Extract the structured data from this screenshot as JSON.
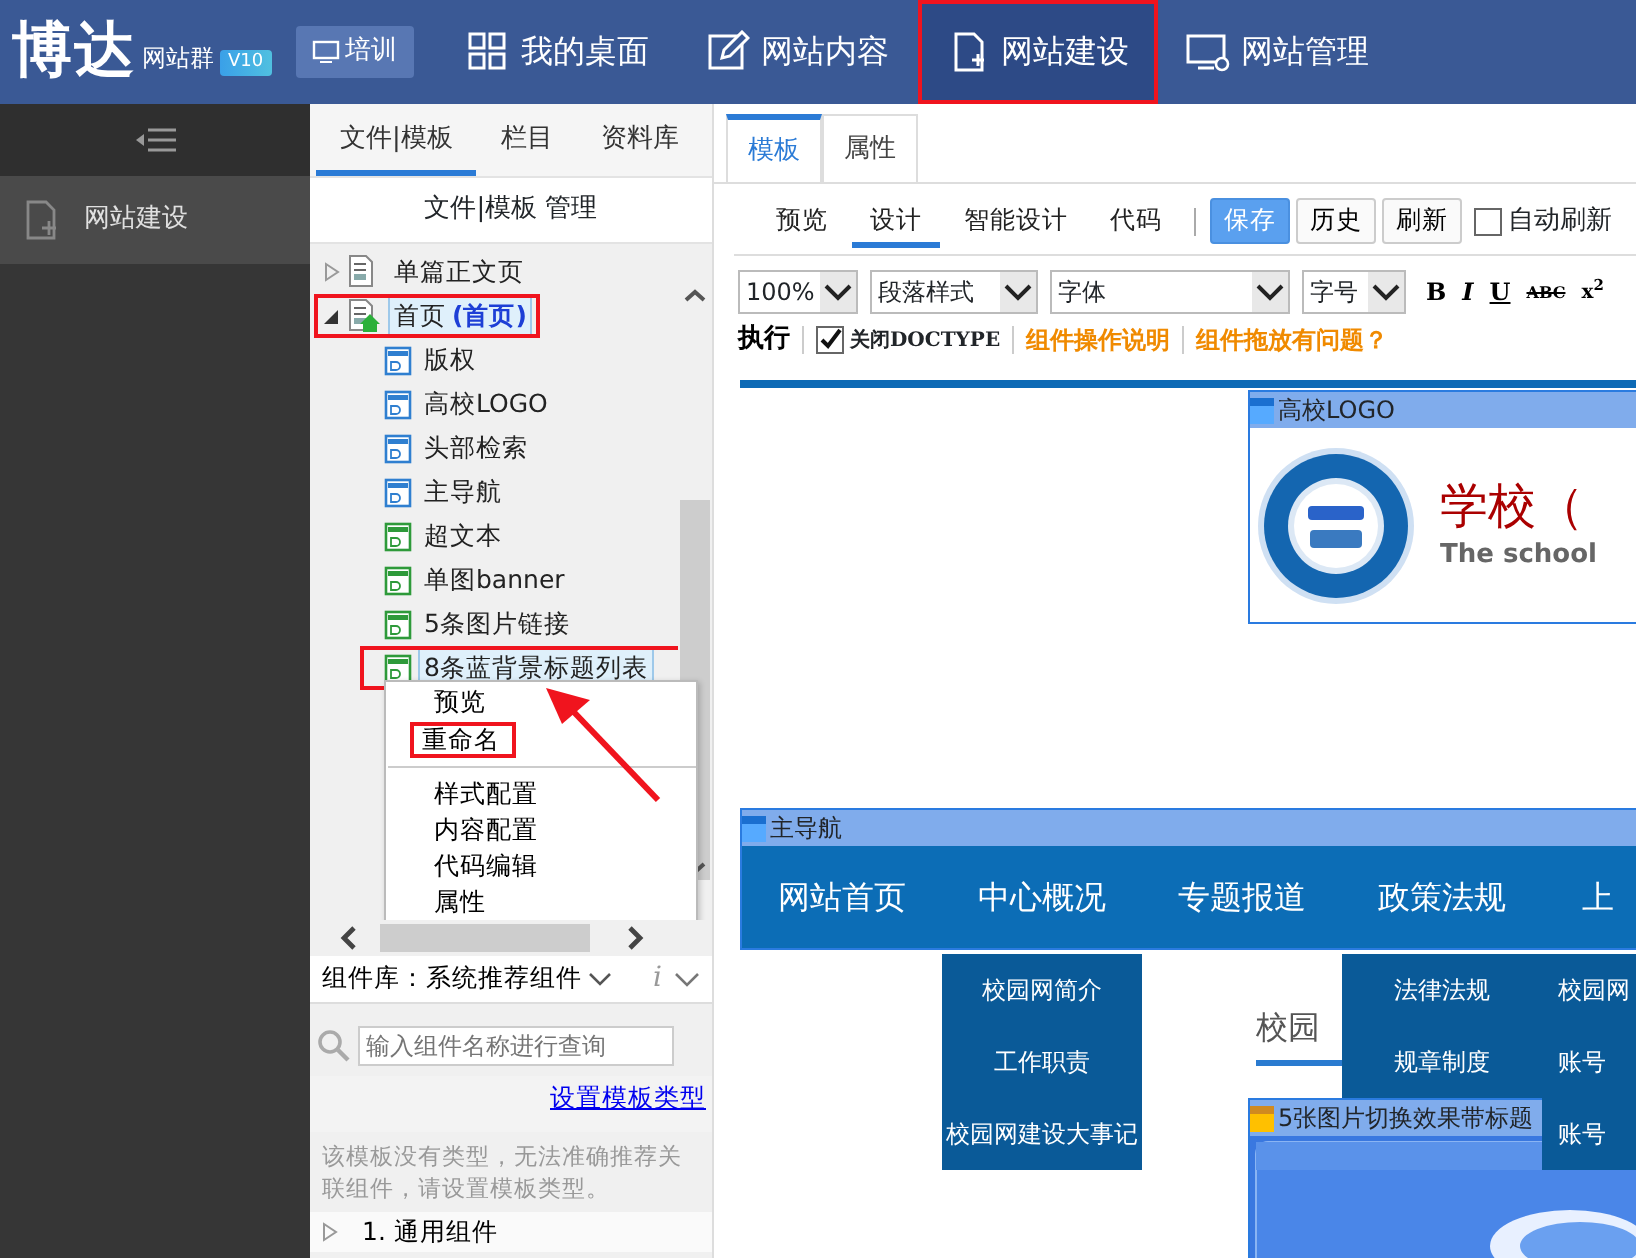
{
  "header": {
    "logo": "博达",
    "product": "网站群",
    "version": "V10",
    "training_button": "培训",
    "nav": [
      {
        "label": "我的桌面",
        "selected": false,
        "highlighted": false
      },
      {
        "label": "网站内容",
        "selected": false,
        "highlighted": false
      },
      {
        "label": "网站建设",
        "selected": true,
        "highlighted": true
      },
      {
        "label": "网站管理",
        "selected": false,
        "highlighted": false
      }
    ]
  },
  "sidebar": {
    "items": [
      {
        "label": "网站建设",
        "selected": true
      }
    ]
  },
  "file_panel": {
    "tabs": [
      {
        "label": "文件|模板",
        "selected": true
      },
      {
        "label": "栏目",
        "selected": false
      },
      {
        "label": "资料库",
        "selected": false
      }
    ],
    "title": "文件|模板 管理",
    "tree": [
      {
        "label": "单篇正文页",
        "kind": "page",
        "expanded": false,
        "selected": false,
        "highlighted": false
      },
      {
        "label": "首页",
        "tag": "(首页)",
        "kind": "home",
        "expanded": true,
        "selected": true,
        "highlighted": true,
        "children": [
          {
            "label": "版权",
            "kind": "blue",
            "selected": false,
            "highlighted": false
          },
          {
            "label": "高校LOGO",
            "kind": "blue",
            "selected": false,
            "highlighted": false
          },
          {
            "label": "头部检索",
            "kind": "blue",
            "selected": false,
            "highlighted": false
          },
          {
            "label": "主导航",
            "kind": "blue",
            "selected": false,
            "highlighted": false
          },
          {
            "label": "超文本",
            "kind": "green",
            "selected": false,
            "highlighted": false
          },
          {
            "label": "单图banner",
            "kind": "green",
            "selected": false,
            "highlighted": false
          },
          {
            "label": "5条图片链接",
            "kind": "green",
            "selected": false,
            "highlighted": false
          },
          {
            "label": "8条蓝背景标题列表",
            "kind": "green",
            "selected": true,
            "highlighted": true
          }
        ]
      }
    ],
    "context_menu": {
      "sections": [
        {
          "items": [
            {
              "label": "预览",
              "highlighted": false
            },
            {
              "label": "重命名",
              "highlighted": true
            }
          ]
        },
        {
          "items": [
            {
              "label": "样式配置",
              "highlighted": false
            },
            {
              "label": "内容配置",
              "highlighted": false
            },
            {
              "label": "代码编辑",
              "highlighted": false
            },
            {
              "label": "属性",
              "highlighted": false
            }
          ]
        }
      ]
    },
    "component_library": {
      "title": "组件库：系统推荐组件",
      "info": "i",
      "search": {
        "placeholder": "输入组件名称进行查询"
      },
      "link": "设置模板类型",
      "message": "该模板没有类型，无法准确推荐关联组件，请设置模板类型。",
      "categories": [
        {
          "label": "1. 通用组件",
          "expanded": false
        }
      ]
    }
  },
  "editor": {
    "tabs": [
      {
        "label": "模板",
        "selected": true
      },
      {
        "label": "属性",
        "selected": false
      }
    ],
    "view_tabs": [
      {
        "label": "预览",
        "selected": false
      },
      {
        "label": "设计",
        "selected": true
      },
      {
        "label": "智能设计",
        "selected": false
      },
      {
        "label": "代码",
        "selected": false
      }
    ],
    "buttons": [
      {
        "label": "保存",
        "kind": "primary"
      },
      {
        "label": "历史",
        "kind": "default"
      },
      {
        "label": "刷新",
        "kind": "default"
      }
    ],
    "auto_refresh": {
      "label": "自动刷新",
      "checked": false
    },
    "format": {
      "zoom": "100%",
      "paragraph": "段落样式",
      "font": "字体",
      "size": "字号"
    },
    "format_buttons": [
      {
        "label": "B",
        "kind": "bold"
      },
      {
        "label": "I",
        "kind": "italic"
      },
      {
        "label": "U",
        "kind": "underline"
      },
      {
        "label": "ABC",
        "kind": "strike"
      },
      {
        "label": "x$^{2}$",
        "kind": "sup"
      }
    ],
    "execute": "执行",
    "doctype": {
      "label": "关闭DOCTYPE",
      "checked": true
    },
    "help_links": [
      "组件操作说明",
      "组件拖放有问题？"
    ],
    "canvas": {
      "logo_module": {
        "title": "高校LOGO",
        "school_name": "学校（",
        "school_name_en": "The school"
      },
      "nav_module": {
        "title": "主导航",
        "items": [
          "网站首页",
          "中心概况",
          "专题报道",
          "政策法规",
          "上"
        ],
        "dropdowns": [
          {
            "items": [
              "校园网简介",
              "工作职责",
              "校园网建设大事记"
            ]
          },
          {
            "items": [
              "法律法规",
              "规章制度"
            ]
          },
          {
            "items": [
              "校园网",
              "账号",
              "账号"
            ]
          }
        ]
      },
      "background_heading": "校园",
      "slider_module": {
        "title": "5张图片切换效果带标题"
      }
    }
  }
}
